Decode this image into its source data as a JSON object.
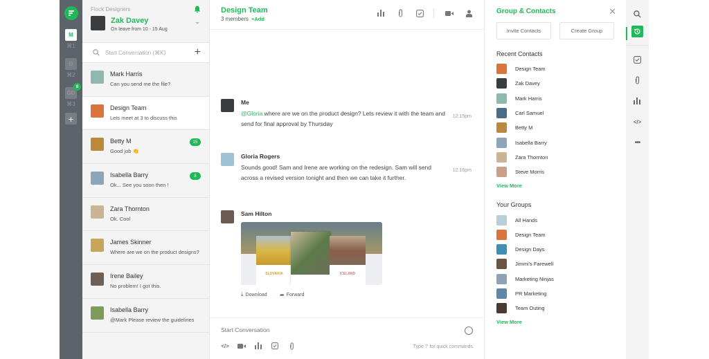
{
  "colors": {
    "accent": "#20b95a",
    "rail": "#5c6369"
  },
  "rail": {
    "teams": [
      {
        "label": "M",
        "shortcut": "⌘1",
        "active": true
      },
      {
        "label": "D",
        "shortcut": "⌘2",
        "active": false
      },
      {
        "label": "GD",
        "shortcut": "⌘3",
        "active": false,
        "badge": "8"
      }
    ],
    "add_label": "+"
  },
  "profile": {
    "org": "Flock Designers",
    "name": "Zak Davey",
    "status": "On leave from 10 - 15 Aug"
  },
  "search": {
    "placeholder": "Start Conversation (⌘K)"
  },
  "chats": [
    {
      "name": "Mark Harris",
      "preview": "Can you send me the file?",
      "avatar": "#8fb8b0"
    },
    {
      "name": "Design Team",
      "preview": "Lets meet at 3 to discuss this",
      "avatar": "#d9743c",
      "active": true
    },
    {
      "name": "Betty M",
      "preview": "Good job 👏",
      "avatar": "#b98a3c",
      "badge": "15"
    },
    {
      "name": "Isabella Barry",
      "preview": "Ok... See you soon then !",
      "avatar": "#8da5b8",
      "badge": "8"
    },
    {
      "name": "Zara Thornton",
      "preview": "Ok. Cool",
      "avatar": "#c9b494"
    },
    {
      "name": "James Skinner",
      "preview": "Where are we on the product designs?",
      "avatar": "#c6a65b"
    },
    {
      "name": "Irene Bailey",
      "preview": "No problem! I got this.",
      "avatar": "#6f6055"
    },
    {
      "name": "Isabella Barry",
      "preview": "@Mark Please review the guidelines",
      "avatar": "#7e9a5a"
    }
  ],
  "conversation": {
    "title": "Design Team",
    "members": "3 members",
    "add_label": "+Add",
    "messages": [
      {
        "author": "Me",
        "mention": "@Gloria",
        "text": " where are we on the product design? Lets review it with the team and send for final approval by Thursday",
        "time": "12:15pm",
        "avatar": "#3a3d40"
      },
      {
        "author": "Gloria Rogers",
        "mention": "",
        "text": "Sounds good! Sam and Irene are working on the redesign. Sam will send across a revised version tonight and then we can take it further.",
        "time": "12:16pm",
        "avatar": "#9fc3d6"
      },
      {
        "author": "Sam Hilton",
        "attachment": {
          "cards": [
            "SLOVAKIA",
            "",
            "ICELAND"
          ]
        },
        "avatar": "#6b5a50"
      }
    ],
    "attachment_actions": {
      "download": "Download",
      "forward": "Forward"
    },
    "composer": {
      "placeholder": "Start Conversation",
      "hint": "Type '/' for quick commands"
    }
  },
  "panel": {
    "title": "Group & Contacts",
    "invite_label": "Invite Contacts",
    "create_label": "Create Group",
    "recent_title": "Recent Contacts",
    "recent": [
      {
        "name": "Design Team",
        "avatar": "#d9743c"
      },
      {
        "name": "Zak Davey",
        "avatar": "#3a3d40"
      },
      {
        "name": "Mark Harris",
        "avatar": "#8fb8b0"
      },
      {
        "name": "Carl Samuel",
        "avatar": "#4a6b8a"
      },
      {
        "name": "Betty M",
        "avatar": "#b98a3c"
      },
      {
        "name": "Isabella Barry",
        "avatar": "#8da5b8"
      },
      {
        "name": "Zara Thornton",
        "avatar": "#c9b494"
      },
      {
        "name": "Steve Morris",
        "avatar": "#c9a08a"
      }
    ],
    "view_more": "View More",
    "groups_title": "Your Groups",
    "groups": [
      {
        "name": "All Hands",
        "avatar": "#b9cfd8"
      },
      {
        "name": "Design Team",
        "avatar": "#d9743c"
      },
      {
        "name": "Design Days",
        "avatar": "#3e8fb3"
      },
      {
        "name": "Jimmi's Farewell",
        "avatar": "#6b5440"
      },
      {
        "name": "Marketing Ninjas",
        "avatar": "#8fa2b5"
      },
      {
        "name": "PR Marketing",
        "avatar": "#5f87a6"
      },
      {
        "name": "Team Outing",
        "avatar": "#4b3a30"
      }
    ]
  }
}
